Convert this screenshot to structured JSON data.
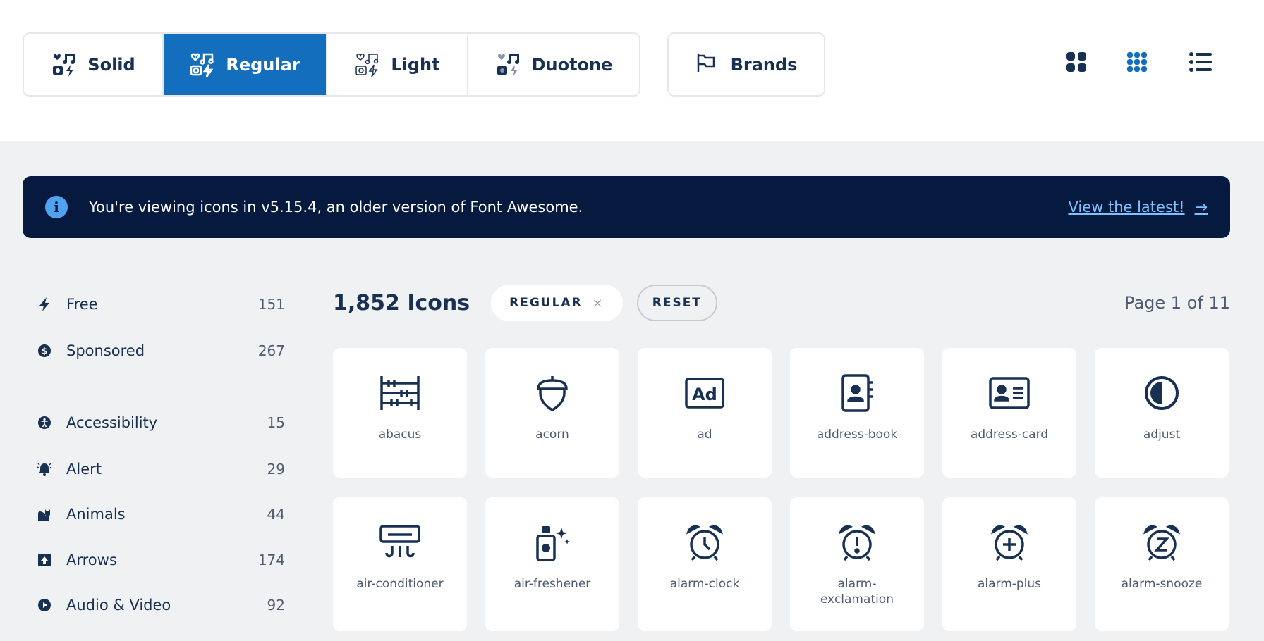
{
  "style_tabs": [
    {
      "label": "Solid",
      "icon": "solid-style-icon",
      "active": false
    },
    {
      "label": "Regular",
      "icon": "regular-style-icon",
      "active": true
    },
    {
      "label": "Light",
      "icon": "light-style-icon",
      "active": false
    },
    {
      "label": "Duotone",
      "icon": "duotone-style-icon",
      "active": false
    }
  ],
  "brands": {
    "label": "Brands",
    "icon": "flag-icon"
  },
  "view_modes": [
    "large-grid-icon",
    "small-grid-icon",
    "list-icon"
  ],
  "banner": {
    "message": "You're viewing icons in v5.15.4, an older version of Font Awesome.",
    "link": "View the latest!",
    "arrow": "→"
  },
  "sidebar": {
    "items": [
      {
        "label": "Free",
        "count": "151",
        "icon": "bolt-icon"
      },
      {
        "label": "Sponsored",
        "count": "267",
        "icon": "dollar-circle-icon"
      },
      {
        "label": "Accessibility",
        "count": "15",
        "icon": "universal-access-icon"
      },
      {
        "label": "Alert",
        "count": "29",
        "icon": "bell-icon"
      },
      {
        "label": "Animals",
        "count": "44",
        "icon": "cat-icon"
      },
      {
        "label": "Arrows",
        "count": "174",
        "icon": "arrow-square-up-icon"
      },
      {
        "label": "Audio & Video",
        "count": "92",
        "icon": "play-circle-icon"
      }
    ]
  },
  "results": {
    "count_label": "1,852 Icons",
    "filter_pill": "REGULAR",
    "filter_remove": "×",
    "reset": "RESET",
    "page_info": "Page 1 of 11"
  },
  "icons": [
    {
      "name": "abacus"
    },
    {
      "name": "acorn"
    },
    {
      "name": "ad"
    },
    {
      "name": "address-book"
    },
    {
      "name": "address-card"
    },
    {
      "name": "adjust"
    },
    {
      "name": "air-conditioner"
    },
    {
      "name": "air-freshener"
    },
    {
      "name": "alarm-clock"
    },
    {
      "name": "alarm-exclamation"
    },
    {
      "name": "alarm-plus"
    },
    {
      "name": "alarm-snooze"
    }
  ],
  "colors": {
    "brand_blue": "#146ebe",
    "navy": "#061a3f",
    "ink": "#183153",
    "link": "#7cc2ff"
  }
}
